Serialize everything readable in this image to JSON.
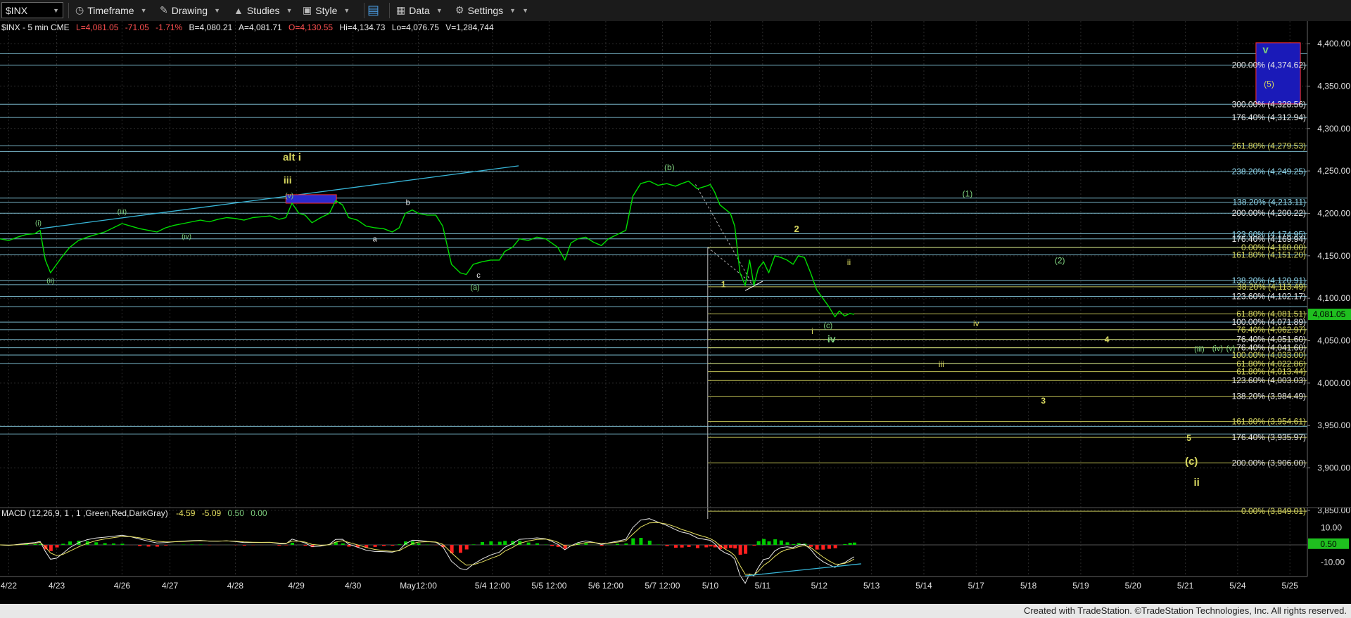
{
  "toolbar": {
    "symbol": "$INX",
    "timeframe": "Timeframe",
    "drawing": "Drawing",
    "studies": "Studies",
    "style": "Style",
    "data": "Data",
    "settings": "Settings"
  },
  "quote": {
    "name": "$INX - 5 min  CME",
    "last": "L=4,081.05",
    "change": "-71.05",
    "pct": "-1.71%",
    "bid": "B=4,080.21",
    "ask": "A=4,081.71",
    "open": "O=4,130.55",
    "high": "Hi=4,134.73",
    "low": "Lo=4,076.75",
    "volume": "V=1,284,744"
  },
  "macd": {
    "label": "MACD (12,26,9, 1 , 1 ,Green,Red,DarkGray)",
    "v1": "-4.59",
    "v2": "-5.09",
    "v3": "0.50",
    "v4": "0.00",
    "current_label": "0.50",
    "ticks": [
      "10.00",
      "-10.00"
    ]
  },
  "footer": "Created with TradeStation. ©TradeStation Technologies, Inc. All rights reserved.",
  "colors": {
    "price": "#00dd00",
    "cyan": "#8fd8ee",
    "yellow": "#d8d860",
    "white": "#e8e8e8",
    "green_label": "#7fd17f",
    "macd_hist_pos": "#00cc00",
    "macd_hist_neg": "#ff2020",
    "last_box": "#1fbf1f"
  },
  "chart_data": {
    "type": "line",
    "title": "$INX - 5 min",
    "ylim": [
      3840,
      4410
    ],
    "yticks": [
      "4,400.00",
      "4,350.00",
      "4,300.00",
      "4,250.00",
      "4,200.00",
      "4,150.00",
      "4,100.00",
      "4,050.00",
      "4,000.00",
      "3,950.00",
      "3,900.00",
      "3,850.00"
    ],
    "ytick_values": [
      4400,
      4350,
      4300,
      4250,
      4200,
      4150,
      4100,
      4050,
      4000,
      3950,
      3900,
      3850
    ],
    "xticks": [
      "4/22",
      "4/23",
      "4/26",
      "4/27",
      "4/28",
      "4/29",
      "4/30",
      "May12:00",
      "5/4 12:00",
      "5/5 12:00",
      "5/6 12:00",
      "5/7 12:00",
      "5/10",
      "5/11",
      "5/12",
      "5/13",
      "5/14",
      "5/17",
      "5/18",
      "5/19",
      "5/20",
      "5/21",
      "5/24",
      "5/25"
    ],
    "xtick_index": [
      1,
      6.5,
      14,
      19.5,
      27,
      34,
      40.5,
      48,
      56.5,
      63,
      69.5,
      76,
      81.5,
      87.5,
      94,
      100,
      106,
      112,
      118,
      124,
      130,
      136,
      142,
      148
    ],
    "x_range": [
      0,
      150
    ],
    "last_price": "4,081.05",
    "last_value": 4081.05,
    "price_series": [
      [
        0,
        4170
      ],
      [
        1,
        4168
      ],
      [
        2,
        4172
      ],
      [
        3,
        4175
      ],
      [
        4,
        4176
      ],
      [
        4.6,
        4180
      ],
      [
        5.2,
        4145
      ],
      [
        5.8,
        4130
      ],
      [
        6.5,
        4140
      ],
      [
        7.2,
        4150
      ],
      [
        8,
        4160
      ],
      [
        9,
        4168
      ],
      [
        10,
        4172
      ],
      [
        11,
        4175
      ],
      [
        12,
        4178
      ],
      [
        13,
        4183
      ],
      [
        14,
        4188
      ],
      [
        15,
        4185
      ],
      [
        16,
        4182
      ],
      [
        17,
        4180
      ],
      [
        18,
        4178
      ],
      [
        19,
        4183
      ],
      [
        20,
        4186
      ],
      [
        21,
        4188
      ],
      [
        22,
        4190
      ],
      [
        23,
        4192
      ],
      [
        24,
        4190
      ],
      [
        25,
        4193
      ],
      [
        26,
        4195
      ],
      [
        27,
        4194
      ],
      [
        28,
        4192
      ],
      [
        29,
        4195
      ],
      [
        30,
        4196
      ],
      [
        31,
        4197
      ],
      [
        32,
        4193
      ],
      [
        32.8,
        4195
      ],
      [
        33.5,
        4212
      ],
      [
        34.3,
        4200
      ],
      [
        35,
        4198
      ],
      [
        35.8,
        4189
      ],
      [
        36.8,
        4195
      ],
      [
        37.8,
        4200
      ],
      [
        38.5,
        4215
      ],
      [
        39.3,
        4210
      ],
      [
        40,
        4195
      ],
      [
        41,
        4192
      ],
      [
        42,
        4185
      ],
      [
        43,
        4183
      ],
      [
        44,
        4182
      ],
      [
        45,
        4178
      ],
      [
        45.8,
        4183
      ],
      [
        46.5,
        4200
      ],
      [
        47.3,
        4204
      ],
      [
        48,
        4200
      ],
      [
        49,
        4198
      ],
      [
        50,
        4198
      ],
      [
        50.8,
        4185
      ],
      [
        51.8,
        4140
      ],
      [
        52.8,
        4130
      ],
      [
        53.5,
        4128
      ],
      [
        54.3,
        4140
      ],
      [
        55.3,
        4143
      ],
      [
        56.3,
        4145
      ],
      [
        57.3,
        4145
      ],
      [
        57.9,
        4155
      ],
      [
        58.8,
        4160
      ],
      [
        59.6,
        4170
      ],
      [
        60.6,
        4168
      ],
      [
        61.6,
        4172
      ],
      [
        62.6,
        4170
      ],
      [
        63.3,
        4165
      ],
      [
        64,
        4160
      ],
      [
        64.8,
        4145
      ],
      [
        65.5,
        4165
      ],
      [
        66.3,
        4170
      ],
      [
        67.2,
        4172
      ],
      [
        68.1,
        4166
      ],
      [
        69,
        4162
      ],
      [
        69.8,
        4170
      ],
      [
        70.8,
        4175
      ],
      [
        71.8,
        4180
      ],
      [
        72.6,
        4220
      ],
      [
        73.5,
        4235
      ],
      [
        74.5,
        4238
      ],
      [
        75.5,
        4233
      ],
      [
        76.5,
        4235
      ],
      [
        77.5,
        4232
      ],
      [
        78.2,
        4235
      ],
      [
        79,
        4238
      ],
      [
        80,
        4229
      ],
      [
        81,
        4232
      ],
      [
        81.5,
        4234
      ],
      [
        82,
        4225
      ],
      [
        82.6,
        4210
      ],
      [
        83.2,
        4205
      ],
      [
        83.8,
        4200
      ],
      [
        84.3,
        4185
      ],
      [
        84.9,
        4130
      ],
      [
        85.5,
        4115
      ],
      [
        86,
        4145
      ],
      [
        86.5,
        4115
      ],
      [
        87,
        4135
      ],
      [
        87.6,
        4143
      ],
      [
        88.2,
        4130
      ],
      [
        88.9,
        4150
      ],
      [
        89.6,
        4148
      ],
      [
        90.3,
        4145
      ],
      [
        91,
        4140
      ],
      [
        91.6,
        4150
      ],
      [
        92.3,
        4148
      ],
      [
        93,
        4130
      ],
      [
        93.7,
        4110
      ],
      [
        94.4,
        4100
      ],
      [
        95.1,
        4090
      ],
      [
        95.8,
        4078
      ],
      [
        96.3,
        4085
      ],
      [
        96.9,
        4079
      ],
      [
        97.5,
        4082
      ],
      [
        98,
        4081
      ]
    ],
    "h_lines_cyan": [
      4388,
      4374.62,
      4328.56,
      4312.94,
      4279.53,
      4273,
      4249.25,
      4218,
      4213.11,
      4200.22,
      4176,
      4169.94,
      4160,
      4151.2,
      4120.91,
      4116,
      4102.17,
      4090,
      4071.89,
      4062.97,
      4051.6,
      4041.6,
      4033,
      4022.86,
      3949,
      3940
    ],
    "h_lines_yellow": [
      4160,
      4113.49,
      4081.51,
      4062.97,
      4051.6,
      4041.6,
      4022.86,
      4013.44,
      4003.03,
      3984.49,
      3954.61,
      3935.97,
      3906,
      3849.01
    ],
    "fib_labels": [
      {
        "t": "200.00% (4,374.62)",
        "v": 4374.62,
        "c": "white"
      },
      {
        "t": "300.00% (4,328.56)",
        "v": 4328.56,
        "c": "white"
      },
      {
        "t": "176.40% (4,312.94)",
        "v": 4312.94,
        "c": "white"
      },
      {
        "t": "261.80% (4,279.53)",
        "v": 4279.53,
        "c": "yellow"
      },
      {
        "t": "238.20% (4,249.25)",
        "v": 4249.25,
        "c": "cyan"
      },
      {
        "t": "138.20% (4,213.11)",
        "v": 4213.11,
        "c": "cyan"
      },
      {
        "t": "200.00% (4,200.22)",
        "v": 4200.22,
        "c": "white"
      },
      {
        "t": "123.60% (4,174.95)",
        "v": 4174.95,
        "c": "cyan"
      },
      {
        "t": "176.40% (4,169.94)",
        "v": 4169.94,
        "c": "white"
      },
      {
        "t": "0.00% (4,160.00)",
        "v": 4160,
        "c": "yellow"
      },
      {
        "t": "161.80% (4,151.20)",
        "v": 4151.2,
        "c": "yellow"
      },
      {
        "t": "138.20% (4,120.91)",
        "v": 4120.91,
        "c": "cyan"
      },
      {
        "t": "38.20% (4,113.49)",
        "v": 4113.49,
        "c": "yellow"
      },
      {
        "t": "123.60% (4,102.17)",
        "v": 4102.17,
        "c": "white"
      },
      {
        "t": "61.80% (4,081.51)",
        "v": 4081.51,
        "c": "yellow"
      },
      {
        "t": "100.00% (4,071.89)",
        "v": 4071.89,
        "c": "white"
      },
      {
        "t": "76.40% (4,062.97)",
        "v": 4062.97,
        "c": "yellow"
      },
      {
        "t": "76.40% (4,051.60)",
        "v": 4051.6,
        "c": "white"
      },
      {
        "t": "76.40% (4,041.60)",
        "v": 4041.6,
        "c": "white"
      },
      {
        "t": "100.00% (4,033.00)",
        "v": 4033,
        "c": "yellow"
      },
      {
        "t": "61.80% (4,022.86)",
        "v": 4022.86,
        "c": "yellow"
      },
      {
        "t": "61.80% (4,013.44)",
        "v": 4013.44,
        "c": "yellow"
      },
      {
        "t": "123.60% (4,003.03)",
        "v": 4003.03,
        "c": "white"
      },
      {
        "t": "138.20% (3,984.49)",
        "v": 3984.49,
        "c": "white"
      },
      {
        "t": "161.80% (3,954.61)",
        "v": 3954.61,
        "c": "yellow"
      },
      {
        "t": "176.40% (3,935.97)",
        "v": 3935.97,
        "c": "white"
      },
      {
        "t": "200.00% (3,906.00)",
        "v": 3906,
        "c": "white"
      },
      {
        "t": "0.00% (3,849.01)",
        "v": 3849.01,
        "c": "yellow"
      }
    ],
    "annotations": [
      {
        "t": "alt i",
        "x": 33.5,
        "v": 4262,
        "c": "yellow",
        "b": true,
        "s": 15
      },
      {
        "t": "iii",
        "x": 33,
        "v": 4235,
        "c": "yellow",
        "b": true,
        "s": 14
      },
      {
        "t": "(iii)",
        "x": 14,
        "v": 4199,
        "c": "green",
        "s": 10
      },
      {
        "t": "(i)",
        "x": 4.4,
        "v": 4186,
        "c": "green",
        "s": 10
      },
      {
        "t": "(ii)",
        "x": 5.8,
        "v": 4118,
        "c": "green",
        "s": 10
      },
      {
        "t": "(iv)",
        "x": 21.4,
        "v": 4170,
        "c": "green",
        "s": 10
      },
      {
        "t": "(v)",
        "x": 33.2,
        "v": 4218,
        "c": "green",
        "s": 10
      },
      {
        "t": "b",
        "x": 46.8,
        "v": 4210,
        "c": "white",
        "s": 11
      },
      {
        "t": "a",
        "x": 43,
        "v": 4167,
        "c": "white",
        "s": 11
      },
      {
        "t": "c",
        "x": 54.9,
        "v": 4124,
        "c": "white",
        "s": 11
      },
      {
        "t": "(a)",
        "x": 54.5,
        "v": 4110,
        "c": "green",
        "s": 11
      },
      {
        "t": "(b)",
        "x": 76.8,
        "v": 4251,
        "c": "green",
        "s": 12
      },
      {
        "t": "1",
        "x": 83,
        "v": 4113,
        "c": "yellow",
        "b": true,
        "s": 12
      },
      {
        "t": "2",
        "x": 91.4,
        "v": 4178,
        "c": "yellow",
        "b": true,
        "s": 13
      },
      {
        "t": "ii",
        "x": 97.4,
        "v": 4139,
        "c": "yellow",
        "s": 12
      },
      {
        "t": "i",
        "x": 93.2,
        "v": 4058,
        "c": "yellow",
        "s": 12
      },
      {
        "t": "(c)",
        "x": 95,
        "v": 4065,
        "c": "green",
        "s": 11
      },
      {
        "t": "iv",
        "x": 95.4,
        "v": 4048,
        "c": "green",
        "b": true,
        "s": 14
      },
      {
        "t": "(1)",
        "x": 111,
        "v": 4220,
        "c": "green",
        "s": 12
      },
      {
        "t": "(2)",
        "x": 121.6,
        "v": 4141,
        "c": "green",
        "s": 12
      },
      {
        "t": "iv",
        "x": 112,
        "v": 4067,
        "c": "yellow",
        "s": 12
      },
      {
        "t": "4",
        "x": 127,
        "v": 4048,
        "c": "yellow",
        "b": true,
        "s": 12
      },
      {
        "t": "iii",
        "x": 108,
        "v": 4019,
        "c": "yellow",
        "s": 12
      },
      {
        "t": "3",
        "x": 119.7,
        "v": 3976,
        "c": "yellow",
        "b": true,
        "s": 12
      },
      {
        "t": "5",
        "x": 136.4,
        "v": 3932,
        "c": "yellow",
        "b": true,
        "s": 12
      },
      {
        "t": "(c)",
        "x": 136.7,
        "v": 3904,
        "c": "yellow",
        "b": true,
        "s": 15
      },
      {
        "t": "ii",
        "x": 137.3,
        "v": 3879,
        "c": "yellow",
        "b": true,
        "s": 15
      },
      {
        "t": "(iii)",
        "x": 137.6,
        "v": 4037,
        "c": "green",
        "s": 11
      },
      {
        "t": "(iv)",
        "x": 139.7,
        "v": 4038,
        "c": "green",
        "s": 11
      },
      {
        "t": "(v)",
        "x": 141.2,
        "v": 4038,
        "c": "green",
        "s": 11
      },
      {
        "t": "v",
        "x": 145.2,
        "v": 4389,
        "c": "green",
        "b": true,
        "s": 15
      },
      {
        "t": "(5)",
        "x": 145.6,
        "v": 4349,
        "c": "yellow",
        "s": 12
      }
    ]
  }
}
